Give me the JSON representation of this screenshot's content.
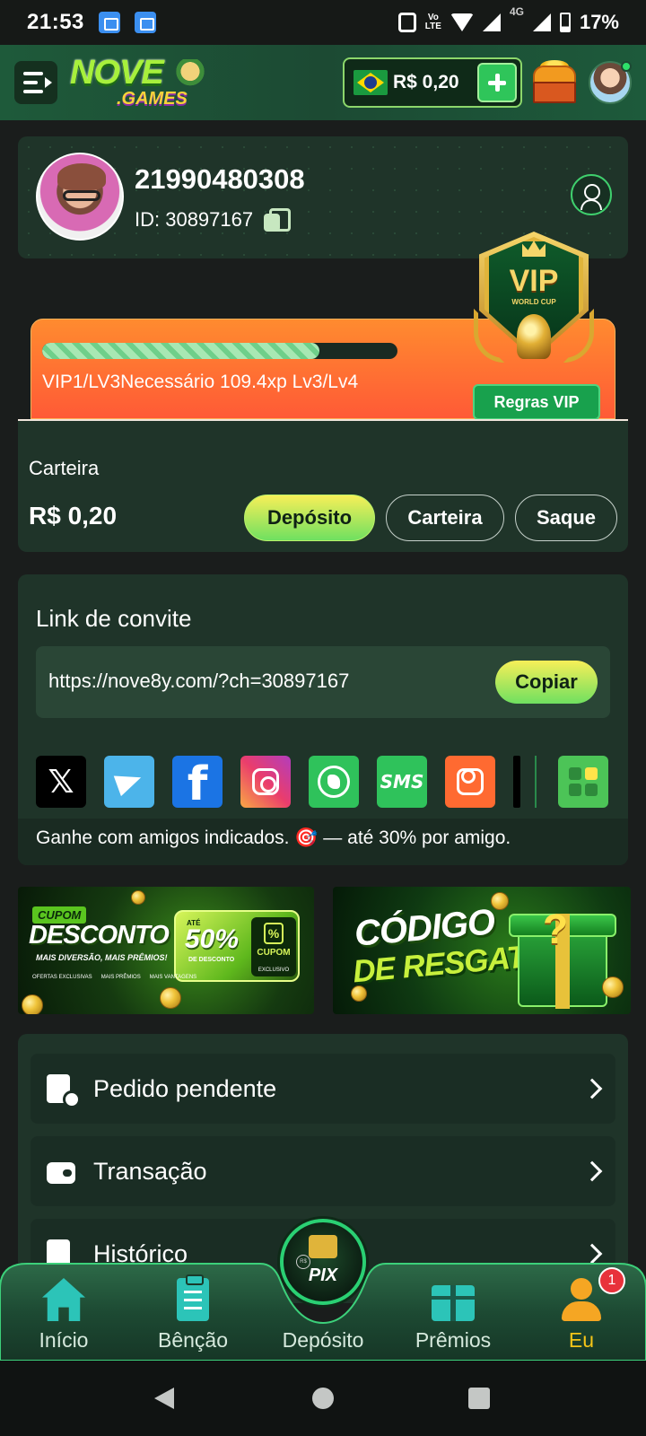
{
  "status_bar": {
    "time": "21:53",
    "volte_top": "Vo",
    "volte_bottom": "LTE",
    "network": "4G",
    "battery": "17%"
  },
  "header": {
    "logo_top": "NOVE",
    "logo_bottom": ".GAMES",
    "balance": "R$ 0,20",
    "flag_icon": "brazil-flag-icon"
  },
  "profile": {
    "username": "21990480308",
    "id_label": "ID: 30897167"
  },
  "vip": {
    "badge_title": "VIP",
    "badge_subtitle": "WORLD CUP",
    "progress_percent": 78,
    "status_text": "VIP1/LV3Necessário 109.4xp Lv3/Lv4",
    "rules_label": "Regras VIP"
  },
  "wallet": {
    "title": "Carteira",
    "amount": "R$ 0,20",
    "deposit_label": "Depósito",
    "wallet_label": "Carteira",
    "withdraw_label": "Saque"
  },
  "invite": {
    "title": "Link de convite",
    "url": "https://nove8y.com/?ch=30897167",
    "copy_label": "Copiar",
    "share_x": "𝕏",
    "share_fb": "f",
    "share_sms": "SMS",
    "info": "Ganhe com amigos indicados. 🎯 — até 30% por amigo."
  },
  "banners": {
    "b1_tag": "CUPOM",
    "b1_title": "DESCONTO",
    "b1_sub": "MAIS DIVERSÃO, MAIS PRÊMIOS!",
    "b1_ate": "ATÉ",
    "b1_percent": "50%",
    "b1_desc": "DE DESCONTO",
    "b1_pct_sign": "%",
    "b1_cupom": "CUPOM",
    "b1_excl": "EXCLUSIVO",
    "b1_feat1": "OFERTAS EXCLUSIVAS",
    "b1_feat2": "MAIS PRÊMIOS",
    "b1_feat3": "MAIS VANTAGENS",
    "b2_title1": "CÓDIGO",
    "b2_title2": "DE RESGATE",
    "b2_q": "?"
  },
  "menu": {
    "items": [
      {
        "label": "Pedido pendente"
      },
      {
        "label": "Transação"
      },
      {
        "label": "Histórico"
      }
    ]
  },
  "bottom_nav": {
    "items": [
      {
        "label": "Início"
      },
      {
        "label": "Bênção"
      },
      {
        "label": "Depósito"
      },
      {
        "label": "Prêmios"
      },
      {
        "label": "Eu"
      }
    ],
    "pix_label": "PIX",
    "pix_rs": "R$",
    "badge_count": "1"
  },
  "colors": {
    "accent_green": "#2fc55a",
    "vip_orange": "#ff6a36",
    "active_nav": "#f5c518",
    "card_bg": "#1f3429"
  }
}
